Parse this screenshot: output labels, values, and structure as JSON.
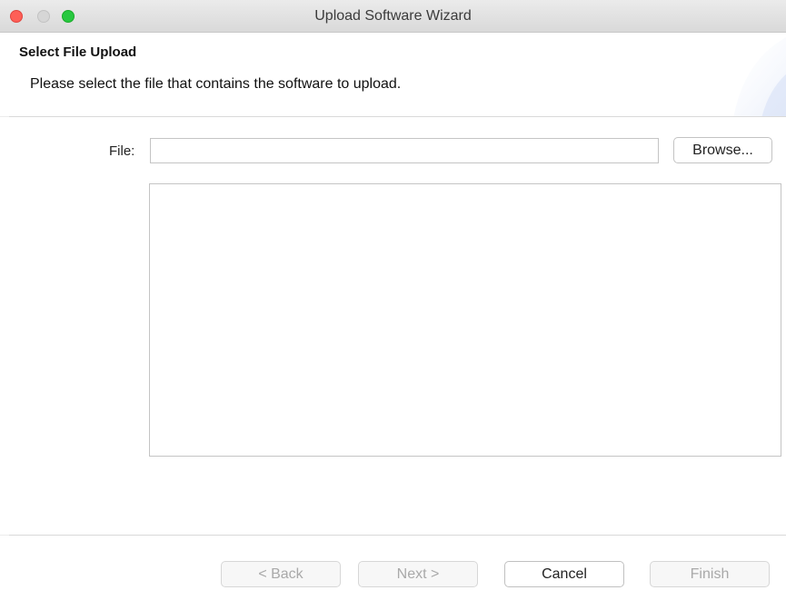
{
  "window": {
    "title": "Upload Software Wizard"
  },
  "banner": {
    "heading": "Select File Upload",
    "description": "Please select the file that contains the software to upload."
  },
  "form": {
    "file_label": "File:",
    "file_value": "",
    "browse_label": "Browse..."
  },
  "footer": {
    "back_label": "< Back",
    "next_label": "Next >",
    "cancel_label": "Cancel",
    "finish_label": "Finish"
  },
  "colors": {
    "close": "#fe5f57",
    "minimize_inactive": "#d6d6d6",
    "maximize": "#28c840"
  },
  "states": {
    "back_enabled": false,
    "next_enabled": false,
    "cancel_enabled": true,
    "finish_enabled": false
  }
}
